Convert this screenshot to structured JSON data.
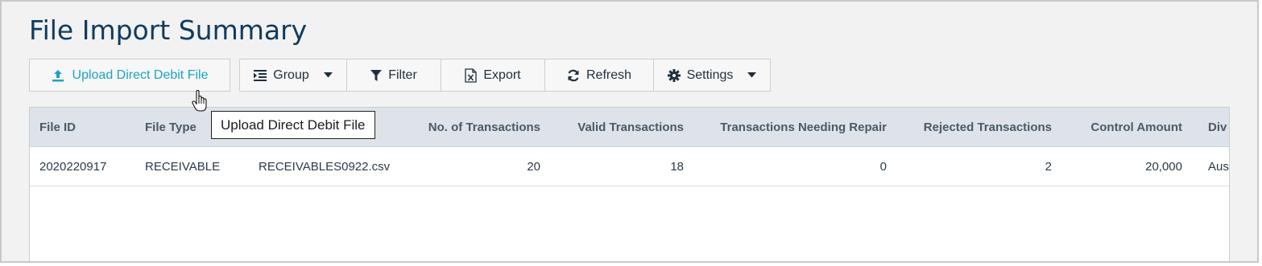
{
  "page": {
    "title": "File Import Summary"
  },
  "toolbar": {
    "upload_label": "Upload Direct Debit File",
    "group_label": "Group",
    "filter_label": "Filter",
    "export_label": "Export",
    "refresh_label": "Refresh",
    "settings_label": "Settings"
  },
  "tooltip": {
    "text": "Upload Direct Debit File"
  },
  "table": {
    "columns": {
      "file_id": "File ID",
      "file_type": "File Type",
      "num_transactions": "No. of Transactions",
      "valid_transactions": "Valid Transactions",
      "needing_repair": "Transactions Needing Repair",
      "rejected": "Rejected Transactions",
      "control_amount": "Control Amount",
      "division": "Div"
    },
    "rows": [
      {
        "file_id": "2020220917",
        "file_type": "RECEIVABLE",
        "file_name": "RECEIVABLES0922.csv",
        "num_transactions": "20",
        "valid_transactions": "18",
        "needing_repair": "0",
        "rejected": "2",
        "control_amount": "20,000",
        "division": "Aus"
      }
    ]
  },
  "icons": {
    "upload": "upload-icon",
    "group": "group-icon",
    "filter": "filter-icon",
    "export": "excel-export-icon",
    "refresh": "refresh-icon",
    "settings": "gear-icon",
    "cursor": "hand-pointer-icon"
  },
  "colors": {
    "title": "#0f3b5f",
    "accent": "#1aa3c7",
    "header_bg": "#dde3e8"
  }
}
